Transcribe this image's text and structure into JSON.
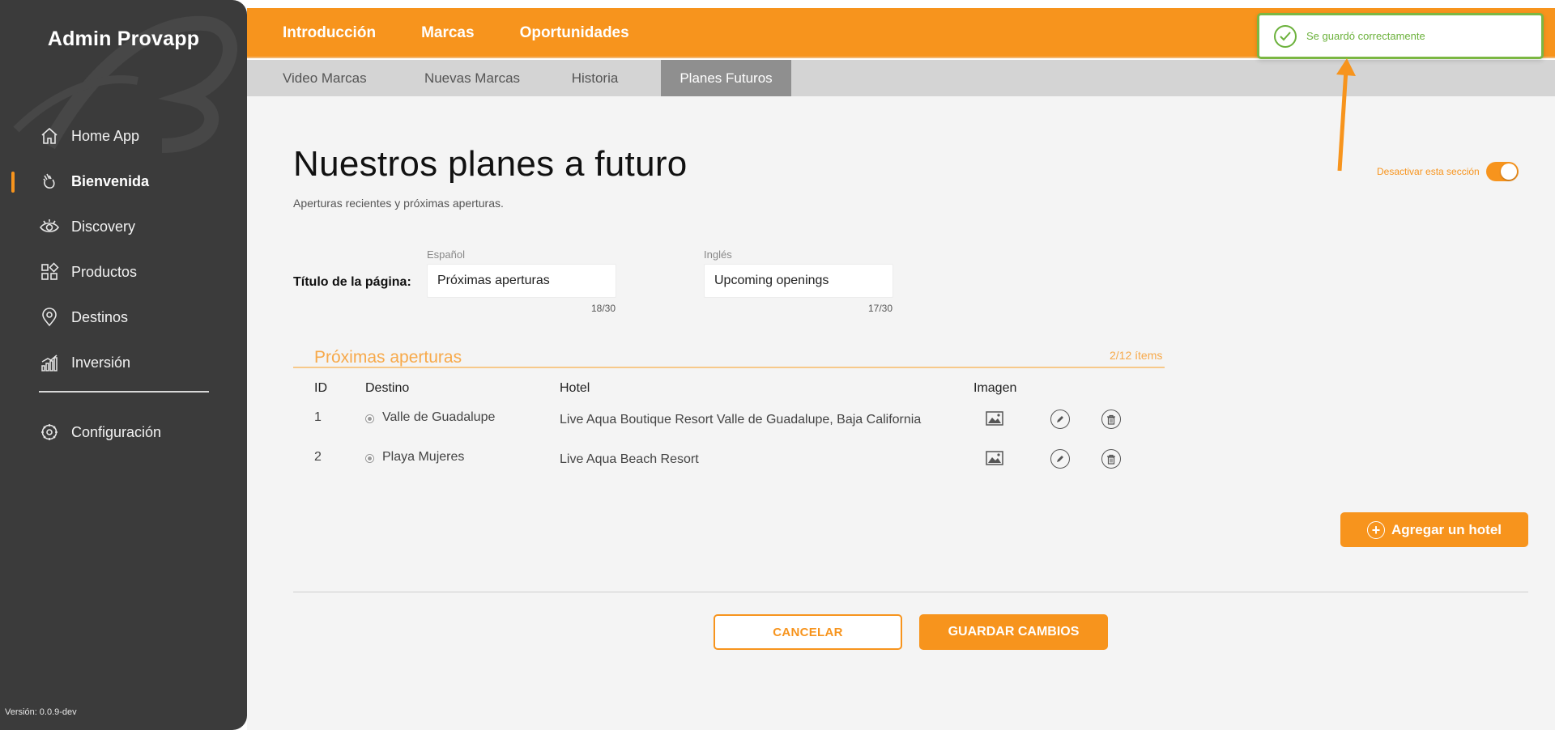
{
  "app": {
    "title": "Admin Provapp",
    "version": "Versión: 0.0.9-dev"
  },
  "sidebar": {
    "items": [
      {
        "label": "Home App",
        "icon": "home-icon"
      },
      {
        "label": "Bienvenida",
        "icon": "wave-hand-icon",
        "active": true
      },
      {
        "label": "Discovery",
        "icon": "eye-icon"
      },
      {
        "label": "Productos",
        "icon": "grid-icon"
      },
      {
        "label": "Destinos",
        "icon": "location-pin-icon"
      },
      {
        "label": "Inversión",
        "icon": "bar-chart-icon"
      }
    ],
    "config": {
      "label": "Configuración",
      "icon": "gear-icon"
    }
  },
  "topnav": {
    "tabs": [
      {
        "label": "Introducción"
      },
      {
        "label": "Marcas",
        "active": true
      },
      {
        "label": "Oportunidades"
      }
    ],
    "subtabs": [
      {
        "label": "Video Marcas"
      },
      {
        "label": "Nuevas Marcas"
      },
      {
        "label": "Historia"
      },
      {
        "label": "Planes Futuros",
        "active": true
      }
    ]
  },
  "page": {
    "title": "Nuestros planes a futuro",
    "subtitle": "Aperturas recientes y próximas aperturas.",
    "toggle_label": "Desactivar esta sección",
    "toggle_on": true
  },
  "title_field": {
    "label": "Título de la página:",
    "es": {
      "lang": "Español",
      "value": "Próximas aperturas",
      "counter": "18/30"
    },
    "en": {
      "lang": "Inglés",
      "value": "Upcoming openings",
      "counter": "17/30"
    }
  },
  "section": {
    "title": "Próximas aperturas",
    "count": "2/12 ítems",
    "columns": {
      "id": "ID",
      "destino": "Destino",
      "hotel": "Hotel",
      "imagen": "Imagen"
    },
    "rows": [
      {
        "id": "1",
        "destino": "Valle de Guadalupe",
        "hotel": "Live Aqua Boutique Resort Valle de Guadalupe, Baja California"
      },
      {
        "id": "2",
        "destino": "Playa Mujeres",
        "hotel": "Live Aqua Beach Resort"
      }
    ],
    "add_label": "Agregar un hotel"
  },
  "actions": {
    "cancel": "CANCELAR",
    "save": "GUARDAR CAMBIOS"
  },
  "toast": {
    "text": "Se guardó correctamente"
  },
  "colors": {
    "accent": "#f7941d",
    "sidebar": "#3b3b3b",
    "success": "#6bb13b"
  }
}
